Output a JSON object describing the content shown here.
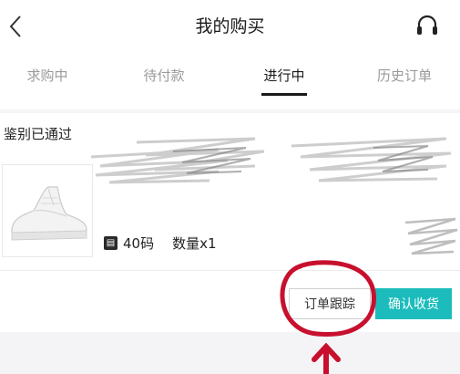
{
  "header": {
    "title": "我的购买",
    "back_icon": "chevron-left-icon",
    "service_icon": "headset-icon"
  },
  "tabs": [
    {
      "label": "求购中",
      "active": false
    },
    {
      "label": "待付款",
      "active": false
    },
    {
      "label": "进行中",
      "active": true
    },
    {
      "label": "历史订单",
      "active": false
    }
  ],
  "order": {
    "status": "鉴别已通过",
    "product_image": "white-high-top-sneaker",
    "size": "40码",
    "quantity": "数量x1",
    "spec_icon": "size-tag-icon"
  },
  "actions": {
    "track_label": "订单跟踪",
    "confirm_label": "确认收货"
  },
  "annotation": {
    "type": "red-circle-and-arrow",
    "color": "#c8102e",
    "target": "order-tracking-button"
  },
  "colors": {
    "accent": "#1cbcbc",
    "annotation": "#c8102e"
  }
}
